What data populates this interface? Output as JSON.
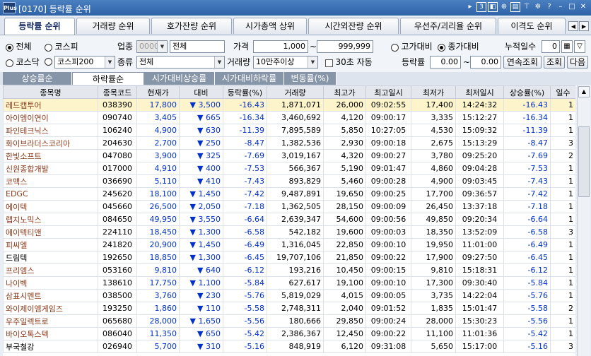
{
  "window": {
    "logo": "Plus",
    "title": "[0170] 등락률 순위",
    "badge": "3"
  },
  "top_tabs": [
    "등락률 순위",
    "거래량 순위",
    "호가잔량 순위",
    "시가총액 상위",
    "시간외잔량 순위",
    "우선주/괴리율 순위",
    "이격도 순위"
  ],
  "filters": {
    "market_all": "전체",
    "market_kospi": "코스피",
    "market_kosdaq": "코스닥",
    "index_value": "코스피200",
    "industry_label": "업종",
    "industry_code": "0000",
    "industry_name": "전체",
    "type_label": "종류",
    "type_value": "전체",
    "price_label": "가격",
    "price_from": "1,000",
    "tilde": "~",
    "price_to": "999,999",
    "volume_label": "거래량",
    "volume_value": "10만주이상",
    "auto_label": "30초 자동",
    "high_compare": "고가대비",
    "close_compare": "종가대비",
    "days_label": "누적일수",
    "days_value": "0",
    "rate_label": "등락률",
    "rate_from": "0.00",
    "rate_to": "0.00",
    "btn_continuous": "연속조회",
    "btn_query": "조회",
    "btn_next": "다음"
  },
  "sub_tabs": [
    "상승률순",
    "하락률순",
    "시가대비상승률",
    "시가대비하락률",
    "변동률(%)"
  ],
  "table": {
    "headers": [
      "종목명",
      "종목코드",
      "현재가",
      "대비",
      "등락률(%)",
      "거래량",
      "최고가",
      "최고일시",
      "최저가",
      "최저일시",
      "상승률(%)",
      "일수"
    ],
    "rows": [
      [
        "레드캡투어",
        "038390",
        "17,800",
        "3,500",
        "-16.43",
        "1,871,071",
        "26,000",
        "09:02:55",
        "17,400",
        "14:24:32",
        "-16.43",
        "1"
      ],
      [
        "아이엠이연이",
        "090740",
        "3,405",
        "665",
        "-16.34",
        "3,460,692",
        "4,120",
        "09:00:17",
        "3,335",
        "15:12:27",
        "-16.34",
        "1"
      ],
      [
        "파인테크닉스",
        "106240",
        "4,900",
        "630",
        "-11.39",
        "7,895,589",
        "5,850",
        "10:27:05",
        "4,530",
        "15:09:32",
        "-11.39",
        "1"
      ],
      [
        "화이브라더스코리아",
        "204630",
        "2,700",
        "250",
        "-8.47",
        "1,382,536",
        "2,930",
        "09:00:18",
        "2,675",
        "15:13:29",
        "-8.47",
        "3"
      ],
      [
        "한빛소프트",
        "047080",
        "3,900",
        "325",
        "-7.69",
        "3,019,167",
        "4,320",
        "09:00:27",
        "3,780",
        "09:25:20",
        "-7.69",
        "2"
      ],
      [
        "신원종합개발",
        "017000",
        "4,910",
        "400",
        "-7.53",
        "566,367",
        "5,190",
        "09:01:47",
        "4,860",
        "09:04:28",
        "-7.53",
        "1"
      ],
      [
        "코맥스",
        "036690",
        "5,110",
        "410",
        "-7.43",
        "893,829",
        "5,460",
        "09:00:28",
        "4,900",
        "09:03:45",
        "-7.43",
        "1"
      ],
      [
        "EDGC",
        "245620",
        "18,100",
        "1,450",
        "-7.42",
        "9,487,891",
        "19,650",
        "09:00:25",
        "17,700",
        "09:36:57",
        "-7.42",
        "1"
      ],
      [
        "에이텍",
        "045660",
        "26,500",
        "2,050",
        "-7.18",
        "1,362,505",
        "28,150",
        "09:00:09",
        "26,450",
        "13:37:18",
        "-7.18",
        "1"
      ],
      [
        "랩지노믹스",
        "084650",
        "49,950",
        "3,550",
        "-6.64",
        "2,639,347",
        "54,600",
        "09:00:56",
        "49,850",
        "09:20:34",
        "-6.64",
        "1"
      ],
      [
        "에이텍티앤",
        "224110",
        "18,450",
        "1,300",
        "-6.58",
        "542,182",
        "19,600",
        "09:00:03",
        "18,350",
        "13:52:09",
        "-6.58",
        "3"
      ],
      [
        "피씨엘",
        "241820",
        "20,900",
        "1,450",
        "-6.49",
        "1,316,045",
        "22,850",
        "09:00:10",
        "19,950",
        "11:01:00",
        "-6.49",
        "1"
      ],
      [
        "드림텍",
        "192650",
        "18,850",
        "1,300",
        "-6.45",
        "19,707,106",
        "21,850",
        "09:00:22",
        "17,900",
        "09:27:50",
        "-6.45",
        "1"
      ],
      [
        "프리엠스",
        "053160",
        "9,810",
        "640",
        "-6.12",
        "193,216",
        "10,450",
        "09:00:15",
        "9,810",
        "15:18:31",
        "-6.12",
        "1"
      ],
      [
        "나이벡",
        "138610",
        "17,750",
        "1,100",
        "-5.84",
        "627,617",
        "19,100",
        "09:00:10",
        "17,300",
        "09:30:40",
        "-5.84",
        "1"
      ],
      [
        "삼표시멘트",
        "038500",
        "3,760",
        "230",
        "-5.76",
        "5,819,029",
        "4,015",
        "09:00:05",
        "3,735",
        "14:22:04",
        "-5.76",
        "1"
      ],
      [
        "와이제이엠게임즈",
        "193250",
        "1,860",
        "110",
        "-5.58",
        "2,748,311",
        "2,040",
        "09:01:52",
        "1,835",
        "15:01:47",
        "-5.58",
        "2"
      ],
      [
        "우주일렉트로",
        "065680",
        "28,000",
        "1,650",
        "-5.56",
        "180,666",
        "29,850",
        "09:00:24",
        "28,000",
        "15:30:23",
        "-5.56",
        "1"
      ],
      [
        "바이오톡스텍",
        "086040",
        "11,350",
        "650",
        "-5.42",
        "2,386,367",
        "12,450",
        "09:00:22",
        "11,100",
        "11:01:36",
        "-5.42",
        "1"
      ],
      [
        "부국철강",
        "026940",
        "5,700",
        "310",
        "-5.16",
        "848,919",
        "6,120",
        "09:31:08",
        "5,650",
        "15:17:00",
        "-5.16",
        "3"
      ]
    ]
  },
  "colors": {
    "accent": "#2f63a8",
    "down": "#0030c8",
    "name": "#8a3a1a",
    "selected_row": "#fdf4cc"
  }
}
